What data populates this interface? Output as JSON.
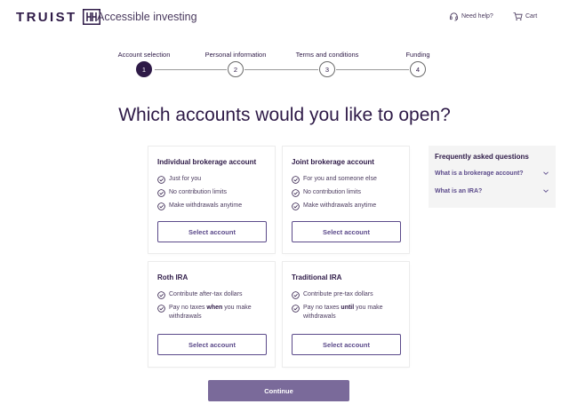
{
  "header": {
    "brand": "TRUIST",
    "product": "Accessible investing",
    "help_label": "Need help?",
    "cart_label": "Cart"
  },
  "stepper": {
    "steps": [
      {
        "label": "Account selection",
        "number": "1",
        "active": true
      },
      {
        "label": "Personal information",
        "number": "2",
        "active": false
      },
      {
        "label": "Terms and conditions",
        "number": "3",
        "active": false
      },
      {
        "label": "Funding",
        "number": "4",
        "active": false
      }
    ]
  },
  "page": {
    "title": "Which accounts would you like to open?"
  },
  "cards": [
    {
      "title": "Individual brokerage account",
      "features": [
        "Just for you",
        "No contribution limits",
        "Make withdrawals anytime"
      ],
      "button": "Select account"
    },
    {
      "title": "Joint brokerage account",
      "features": [
        "For you and someone else",
        "No contribution limits",
        "Make withdrawals anytime"
      ],
      "button": "Select account"
    },
    {
      "title": "Roth IRA",
      "features": [
        {
          "text": "Contribute after-tax dollars"
        },
        {
          "pre": "Pay no taxes ",
          "bold": "when",
          "post": " you make withdrawals"
        }
      ],
      "button": "Select account"
    },
    {
      "title": "Traditional IRA",
      "features": [
        {
          "text": "Contribute pre-tax dollars"
        },
        {
          "pre": "Pay no taxes ",
          "bold": "until",
          "post": " you make withdrawals"
        }
      ],
      "button": "Select account"
    }
  ],
  "faq": {
    "title": "Frequently asked questions",
    "items": [
      "What is a brokerage account?",
      "What is an IRA?"
    ]
  },
  "footer": {
    "continue_label": "Continue"
  },
  "colors": {
    "brand": "#2e1a47",
    "accent": "#5b4a8a",
    "continue_bg": "#7a6a9a",
    "faq_bg": "#f4f4f4"
  }
}
